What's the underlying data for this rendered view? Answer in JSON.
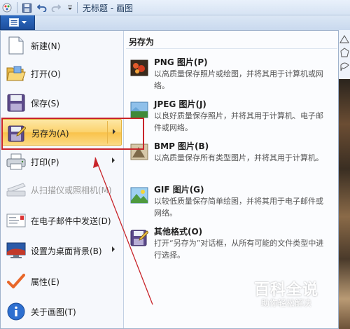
{
  "window": {
    "title": "无标题 - 画图"
  },
  "quick_access": {
    "icons": [
      "paint-app-icon",
      "save-icon",
      "undo-icon",
      "redo-icon",
      "customize-dropdown-icon"
    ]
  },
  "app_menu": {
    "items": [
      {
        "label": "新建(N)",
        "icon": "new-document-icon",
        "has_submenu": false,
        "disabled": false
      },
      {
        "label": "打开(O)",
        "icon": "open-folder-icon",
        "has_submenu": false,
        "disabled": false
      },
      {
        "label": "保存(S)",
        "icon": "save-disk-icon",
        "has_submenu": false,
        "disabled": false
      },
      {
        "label": "另存为(A)",
        "icon": "save-as-icon",
        "has_submenu": true,
        "disabled": false,
        "highlighted": true
      },
      {
        "label": "打印(P)",
        "icon": "printer-icon",
        "has_submenu": true,
        "disabled": false
      },
      {
        "label": "从扫描仪或照相机(M)",
        "icon": "scanner-icon",
        "has_submenu": false,
        "disabled": true
      },
      {
        "label": "在电子邮件中发送(D)",
        "icon": "email-icon",
        "has_submenu": false,
        "disabled": false
      },
      {
        "label": "设置为桌面背景(B)",
        "icon": "desktop-background-icon",
        "has_submenu": true,
        "disabled": false
      },
      {
        "label": "属性(E)",
        "icon": "properties-check-icon",
        "has_submenu": false,
        "disabled": false
      },
      {
        "label": "关于画图(T)",
        "icon": "info-icon",
        "has_submenu": false,
        "disabled": false
      }
    ]
  },
  "save_as_panel": {
    "title": "另存为",
    "options": [
      {
        "title": "PNG 图片(P)",
        "description": "以高质量保存照片或绘图，并将其用于计算机或网络。",
        "icon": "png-image-icon"
      },
      {
        "title": "JPEG 图片(J)",
        "description": "以良好质量保存照片，并将其用于计算机、电子邮件或网络。",
        "icon": "jpeg-image-icon"
      },
      {
        "title": "BMP 图片(B)",
        "description": "以高质量保存所有类型图片，并将其用于计算机。",
        "icon": "bmp-image-icon"
      },
      {
        "title": "GIF 图片(G)",
        "description": "以较低质量保存简单绘图，并将其用于电子邮件或网络。",
        "icon": "gif-image-icon"
      },
      {
        "title": "其他格式(O)",
        "description": "打开“另存为”对话框，从所有可能的文件类型中进行选择。",
        "icon": "other-formats-icon"
      }
    ]
  },
  "watermark": {
    "title": "百科全说",
    "subtitle": "助你轻松解决"
  },
  "colors": {
    "annotation": "#c8242a",
    "highlight": "#fbd26c",
    "app_button": "#1d4f9e"
  }
}
